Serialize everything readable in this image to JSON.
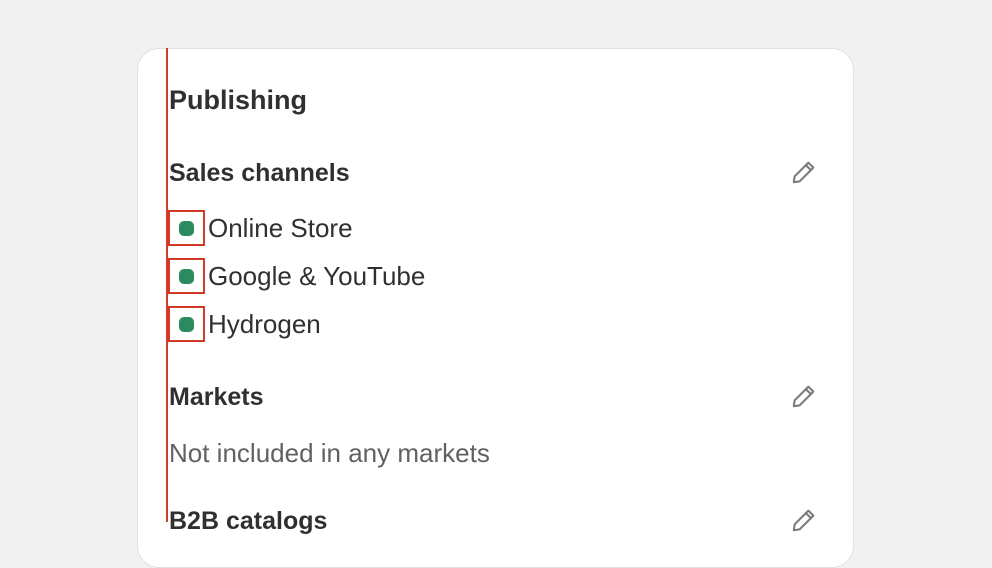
{
  "card": {
    "title": "Publishing"
  },
  "sales_channels": {
    "heading": "Sales channels",
    "edit_icon": "pencil-icon",
    "status_color": "#2b8a5e",
    "items": [
      {
        "label": "Online Store"
      },
      {
        "label": "Google & YouTube"
      },
      {
        "label": "Hydrogen"
      }
    ]
  },
  "markets": {
    "heading": "Markets",
    "edit_icon": "pencil-icon",
    "empty_text": "Not included in any markets"
  },
  "b2b": {
    "heading": "B2B catalogs",
    "edit_icon": "pencil-icon"
  },
  "colors": {
    "highlight": "#d23a2a",
    "status_dot": "#2b8a5e"
  }
}
